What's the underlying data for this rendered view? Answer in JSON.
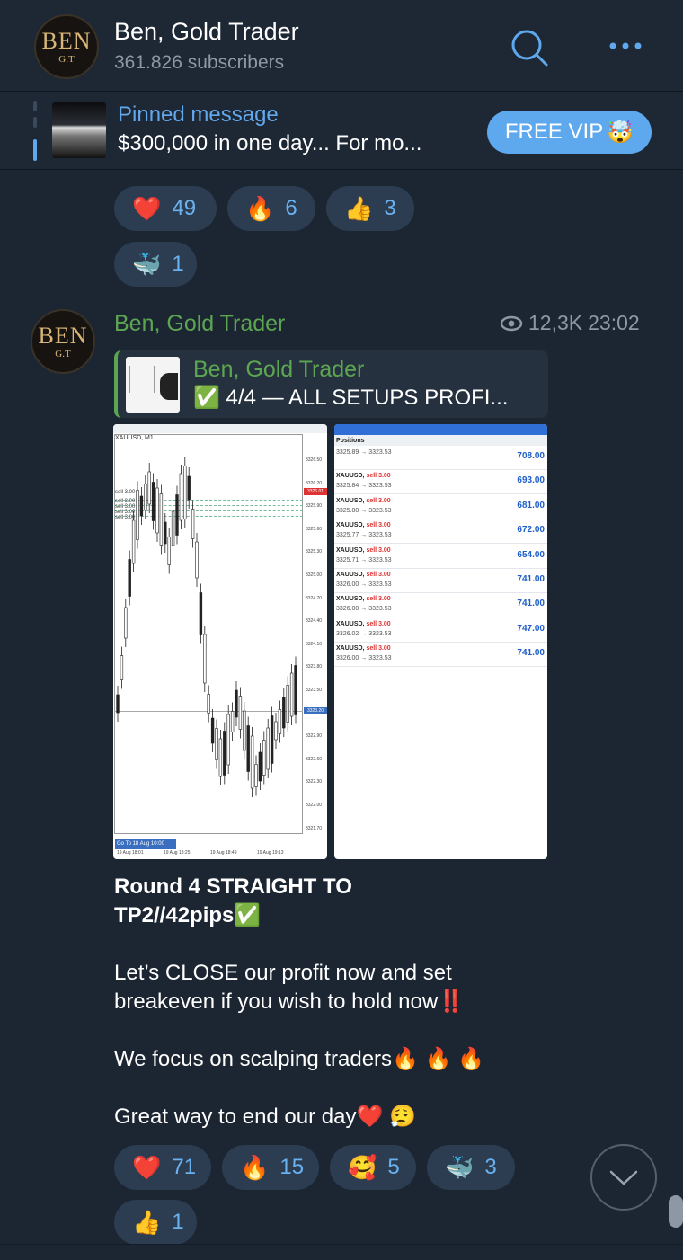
{
  "channel": {
    "avatar_text": "BEN",
    "avatar_sub": "G.T",
    "name": "Ben, Gold Trader",
    "subscribers": "361.826 subscribers",
    "icons": [
      "search-icon",
      "more-icon"
    ]
  },
  "pinned": {
    "title": "Pinned message",
    "text": "$300,000 in one day...   For mo...",
    "button": "FREE VIP",
    "button_emoji": "🤯"
  },
  "prev_reactions": [
    {
      "emoji": "❤️",
      "count": "49"
    },
    {
      "emoji": "🔥",
      "count": "6"
    },
    {
      "emoji": "👍",
      "count": "3"
    },
    {
      "emoji": "🐳",
      "count": "1"
    }
  ],
  "message": {
    "sender": "Ben, Gold Trader",
    "views": "12,3K",
    "time": "23:02",
    "reply": {
      "sender": "Ben, Gold Trader",
      "text": "✅ 4/4 — ALL SETUPS PROFI..."
    },
    "chart": {
      "symbol": "XAUUSD, M1",
      "order_labels": [
        "sell 3.00",
        "sell 3.00",
        "sell 3.00",
        "sell 3.00",
        "sell 3.00"
      ],
      "price_ticks": [
        "3326.50",
        "3326.20",
        "3325.90",
        "3325.60",
        "3325.30",
        "3325.00",
        "3324.70",
        "3324.40",
        "3324.10",
        "3323.80",
        "3323.50",
        "3323.20",
        "3322.90",
        "3322.60",
        "3322.30",
        "3322.00",
        "3321.70"
      ],
      "current_price": "3323.20",
      "top_price": "3326.01",
      "goto": "Go To 18 Aug 10:00",
      "time_ticks": [
        "19 Aug 18:01",
        "19 Aug 18:25",
        "19 Aug 18:49",
        "19 Aug 19:13"
      ]
    },
    "positions": {
      "header": "Positions",
      "rows": [
        {
          "symbol": "",
          "prices": "3325.89 → 3323.53",
          "profit": "708.00"
        },
        {
          "symbol": "XAUUSD, sell 3.00",
          "prices": "3325.84 → 3323.53",
          "profit": "693.00"
        },
        {
          "symbol": "XAUUSD, sell 3.00",
          "prices": "3325.80 → 3323.53",
          "profit": "681.00"
        },
        {
          "symbol": "XAUUSD, sell 3.00",
          "prices": "3325.77 → 3323.53",
          "profit": "672.00"
        },
        {
          "symbol": "XAUUSD, sell 3.00",
          "prices": "3325.71 → 3323.53",
          "profit": "654.00"
        },
        {
          "symbol": "XAUUSD, sell 3.00",
          "prices": "3326.00 → 3323.53",
          "profit": "741.00"
        },
        {
          "symbol": "XAUUSD, sell 3.00",
          "prices": "3326.00 → 3323.53",
          "profit": "741.00"
        },
        {
          "symbol": "XAUUSD, sell 3.00",
          "prices": "3326.02 → 3323.53",
          "profit": "747.00"
        },
        {
          "symbol": "XAUUSD, sell 3.00",
          "prices": "3326.00 → 3323.53",
          "profit": "741.00"
        }
      ]
    },
    "text": {
      "line1": "Round 4 STRAIGHT TO",
      "line2": "TP2//42pips✅",
      "para2_l1": "Let’s CLOSE our profit now and set",
      "para2_l2": "breakeven if you wish to hold now‼️",
      "para3": "We focus on scalping traders🔥 🔥 🔥",
      "para4": "Great way to end our day❤️ 😮‍💨"
    },
    "reactions": [
      {
        "emoji": "❤️",
        "count": "71"
      },
      {
        "emoji": "🔥",
        "count": "15"
      },
      {
        "emoji": "🥰",
        "count": "5"
      },
      {
        "emoji": "🐳",
        "count": "3"
      },
      {
        "emoji": "👍",
        "count": "1"
      }
    ]
  },
  "colors": {
    "background": "#1c2633",
    "accent": "#5ea8ee",
    "sender": "#5da651",
    "reaction_bg": "#2c3d52"
  }
}
